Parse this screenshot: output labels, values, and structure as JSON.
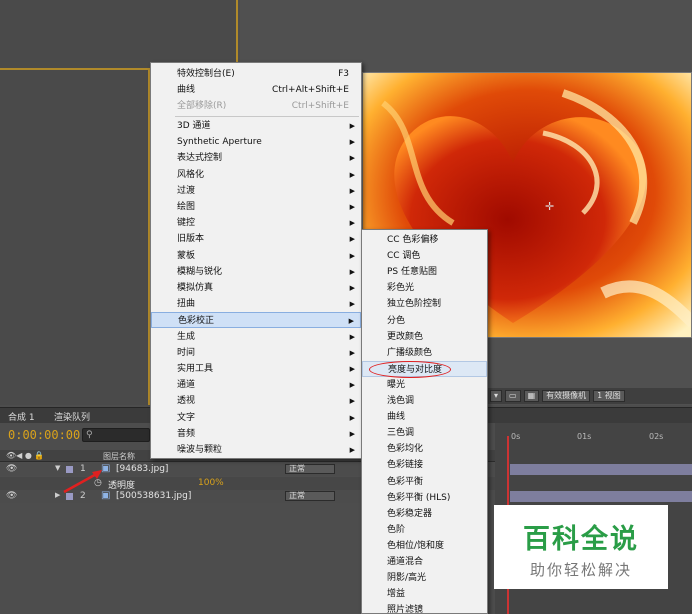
{
  "timeline": {
    "tab_comp": "合成 1",
    "tab_render": "渲染队列",
    "timecode": "0:00:00:00",
    "search_placeholder": "",
    "col_source": "图层名称",
    "ruler": [
      "0s",
      "01s",
      "02s"
    ],
    "layers": [
      {
        "num": "1",
        "name": "[94683.jpg]",
        "mode": "正常"
      },
      {
        "num": "2",
        "name": "[500538631.jpg]",
        "mode": "正常"
      }
    ],
    "opacity_label": "透明度",
    "opacity_value": "100%"
  },
  "viewer_bar": {
    "camera": "有效摄像机",
    "views": "1 视图"
  },
  "menu_main": [
    {
      "label": "特效控制台(E)",
      "shortcut": "F3"
    },
    {
      "label": "曲线",
      "shortcut": "Ctrl+Alt+Shift+E"
    },
    {
      "label": "全部移除(R)",
      "shortcut": "Ctrl+Shift+E",
      "disabled": true
    },
    {
      "label": "3D 通道"
    },
    {
      "label": "Synthetic Aperture"
    },
    {
      "label": "表达式控制"
    },
    {
      "label": "风格化"
    },
    {
      "label": "过渡"
    },
    {
      "label": "绘图"
    },
    {
      "label": "键控"
    },
    {
      "label": "旧版本"
    },
    {
      "label": "蒙板"
    },
    {
      "label": "模糊与锐化"
    },
    {
      "label": "模拟仿真"
    },
    {
      "label": "扭曲"
    },
    {
      "label": "色彩校正"
    },
    {
      "label": "生成"
    },
    {
      "label": "时间"
    },
    {
      "label": "实用工具"
    },
    {
      "label": "通道"
    },
    {
      "label": "透视"
    },
    {
      "label": "文字"
    },
    {
      "label": "音频"
    },
    {
      "label": "噪波与颗粒"
    }
  ],
  "menu_sub": [
    "CC 色彩偏移",
    "CC 调色",
    "PS 任意贴图",
    "彩色光",
    "独立色阶控制",
    "分色",
    "更改颜色",
    "广播级颜色",
    "亮度与对比度",
    "曝光",
    "浅色调",
    "曲线",
    "三色调",
    "色彩均化",
    "色彩链接",
    "色彩平衡",
    "色彩平衡 (HLS)",
    "色彩稳定器",
    "色阶",
    "色相位/饱和度",
    "通道混合",
    "阴影/高光",
    "增益",
    "照片滤镜"
  ],
  "watermark": {
    "title": "百科全说",
    "subtitle": "助你轻松解决"
  }
}
